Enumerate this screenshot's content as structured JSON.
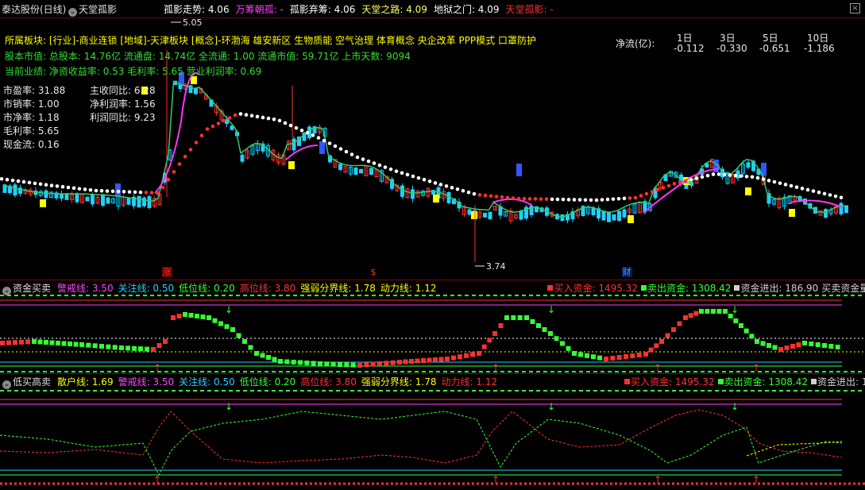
{
  "title": {
    "stock": "泰达股份(日线)",
    "indicator": "天堂孤影",
    "items": [
      {
        "text": "孤影走势: 4.06",
        "color": "#ffffff"
      },
      {
        "text": "万筹朝孤: -",
        "color": "#ff44ff"
      },
      {
        "text": "孤影弃筹: 4.06",
        "color": "#ffffff"
      },
      {
        "text": "天堂之路: 4.09",
        "color": "#ffff66"
      },
      {
        "text": "地狱之门: 4.09",
        "color": "#ffffff"
      },
      {
        "text": "天堂孤影: -",
        "color": "#ff3030"
      }
    ]
  },
  "info": {
    "line1": "所属板块: [行业]-商业连锁 [地域]-天津板块 [概念]-环渤海 雄安新区 生物质能 空气治理 体育概念 央企改革 PPP模式 口罩防护",
    "line2": "股本市值: 总股本: 14.76亿 流通盘: 14.74亿 全流通: 1.00 流通市值: 59.71亿 上市天数: 9094",
    "line3": "当前业绩: 净资收益率: 0.53 毛利率: 5.65 营业利润率: 0.69",
    "left_stats": [
      {
        "label": "市盈率:",
        "value": "31.88"
      },
      {
        "label": "市销率:",
        "value": "1.00"
      },
      {
        "label": "市净率:",
        "value": "1.18"
      },
      {
        "label": "毛利率:",
        "value": "5.65"
      },
      {
        "label": "现金流:",
        "value": "0.16"
      }
    ],
    "right_stats": [
      {
        "label": "主收同比:",
        "value": "6.28"
      },
      {
        "label": "净利润率:",
        "value": "1.56"
      },
      {
        "label": "利润同比:",
        "value": "9.23"
      }
    ]
  },
  "netflow": {
    "label": "净流(亿):",
    "cols": [
      {
        "h": "1日",
        "v": "-0.112"
      },
      {
        "h": "3日",
        "v": "-0.330"
      },
      {
        "h": "5日",
        "v": "-0.651"
      },
      {
        "h": "10日",
        "v": "-1.186"
      }
    ]
  },
  "price_labels": {
    "high": "5.05",
    "low": "3.74"
  },
  "markers": [
    "涨",
    "$",
    "财"
  ],
  "panel2": {
    "name": "资金买卖",
    "items": [
      {
        "text": "警戒线: 3.50",
        "color": "#ff44ff"
      },
      {
        "text": "关注线: 0.50",
        "color": "#20d0ff"
      },
      {
        "text": "低位线: 0.20",
        "color": "#33ff33"
      },
      {
        "text": "高位线: 3.80",
        "color": "#ff3030"
      },
      {
        "text": "强弱分界线: 1.78",
        "color": "#ffff00"
      },
      {
        "text": "动力线: 1.12",
        "color": "#ffff00"
      },
      {
        "text": "买入资金: 1495.32",
        "color": "#ff3030"
      },
      {
        "text": "卖出资金: 1308.42",
        "color": "#33ff33"
      },
      {
        "text": "资金进出: 186.90",
        "color": "#cfcfcf"
      },
      {
        "text": "买卖资金量",
        "color": "#cfcfcf"
      }
    ]
  },
  "panel3": {
    "name": "低买高卖",
    "items": [
      {
        "text": "散户线: 1.69",
        "color": "#ffff00"
      },
      {
        "text": "警戒线: 3.50",
        "color": "#ff44ff"
      },
      {
        "text": "关注线: 0.50",
        "color": "#20d0ff"
      },
      {
        "text": "低位线: 0.20",
        "color": "#33ff33"
      },
      {
        "text": "高位线: 3.80",
        "color": "#ff3030"
      },
      {
        "text": "强弱分界线: 1.78",
        "color": "#ffff00"
      },
      {
        "text": "动力线: 1.12",
        "color": "#ff3030"
      },
      {
        "text": "买入资金: 1495.32",
        "color": "#ff3030"
      },
      {
        "text": "卖出资金: 1308.42",
        "color": "#33ff33"
      },
      {
        "text": "资金进出: 186.90",
        "color": "#cfcfcf"
      }
    ]
  },
  "colors": {
    "up": "#ff3030",
    "down": "#33ff33",
    "accent": "#8b0000"
  }
}
